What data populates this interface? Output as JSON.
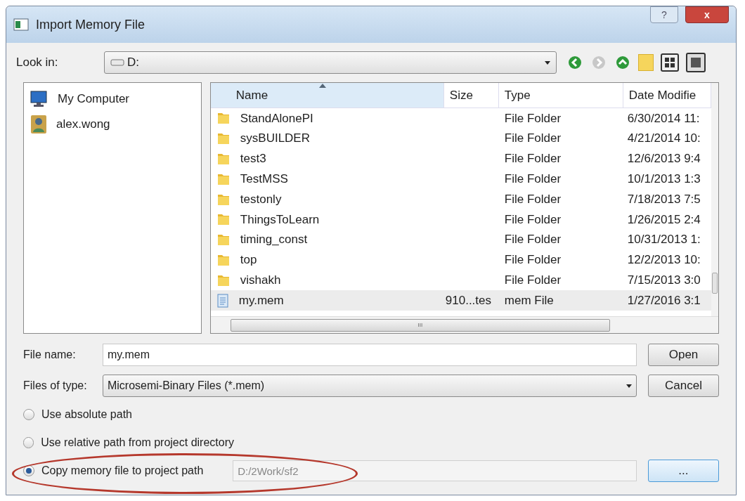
{
  "window": {
    "title": "Import Memory File",
    "help": "?",
    "close": "x"
  },
  "look_in": {
    "label": "Look in:",
    "value": "D:"
  },
  "places": [
    {
      "kind": "computer",
      "label": "My Computer"
    },
    {
      "kind": "user",
      "label": "alex.wong"
    }
  ],
  "columns": [
    {
      "label": "Name",
      "sorted": true
    },
    {
      "label": "Size",
      "sorted": false
    },
    {
      "label": "Type",
      "sorted": false
    },
    {
      "label": "Date Modifie",
      "sorted": false
    }
  ],
  "rows": [
    {
      "kind": "folder",
      "name": "StandAlonePI",
      "size": "",
      "type": "File Folder",
      "date": "6/30/2014 11:",
      "selected": false
    },
    {
      "kind": "folder",
      "name": "sysBUILDER",
      "size": "",
      "type": "File Folder",
      "date": "4/21/2014 10:",
      "selected": false
    },
    {
      "kind": "folder",
      "name": "test3",
      "size": "",
      "type": "File Folder",
      "date": "12/6/2013 9:4",
      "selected": false
    },
    {
      "kind": "folder",
      "name": "TestMSS",
      "size": "",
      "type": "File Folder",
      "date": "10/1/2013 1:3",
      "selected": false
    },
    {
      "kind": "folder",
      "name": "testonly",
      "size": "",
      "type": "File Folder",
      "date": "7/18/2013 7:5",
      "selected": false
    },
    {
      "kind": "folder",
      "name": "ThingsToLearn",
      "size": "",
      "type": "File Folder",
      "date": "1/26/2015 2:4",
      "selected": false
    },
    {
      "kind": "folder",
      "name": "timing_const",
      "size": "",
      "type": "File Folder",
      "date": "10/31/2013 1:",
      "selected": false
    },
    {
      "kind": "folder",
      "name": "top",
      "size": "",
      "type": "File Folder",
      "date": "12/2/2013 10:",
      "selected": false
    },
    {
      "kind": "folder",
      "name": "vishakh",
      "size": "",
      "type": "File Folder",
      "date": "7/15/2013 3:0",
      "selected": false
    },
    {
      "kind": "file",
      "name": "my.mem",
      "size": "910...tes",
      "type": "mem File",
      "date": "1/27/2016 3:1",
      "selected": true
    }
  ],
  "hscroll_grip": "III",
  "file_name": {
    "label": "File name:",
    "value": "my.mem"
  },
  "file_type": {
    "label": "Files of type:",
    "value": "Microsemi-Binary Files (*.mem)"
  },
  "buttons": {
    "open": "Open",
    "cancel": "Cancel",
    "browse": "..."
  },
  "path_options": [
    {
      "label": "Use absolute path",
      "selected": false
    },
    {
      "label": "Use relative path from project directory",
      "selected": false
    },
    {
      "label": "Copy memory file to project path",
      "selected": true
    }
  ],
  "project_path": "D:/2Work/sf2",
  "highlight": {
    "on": true
  }
}
